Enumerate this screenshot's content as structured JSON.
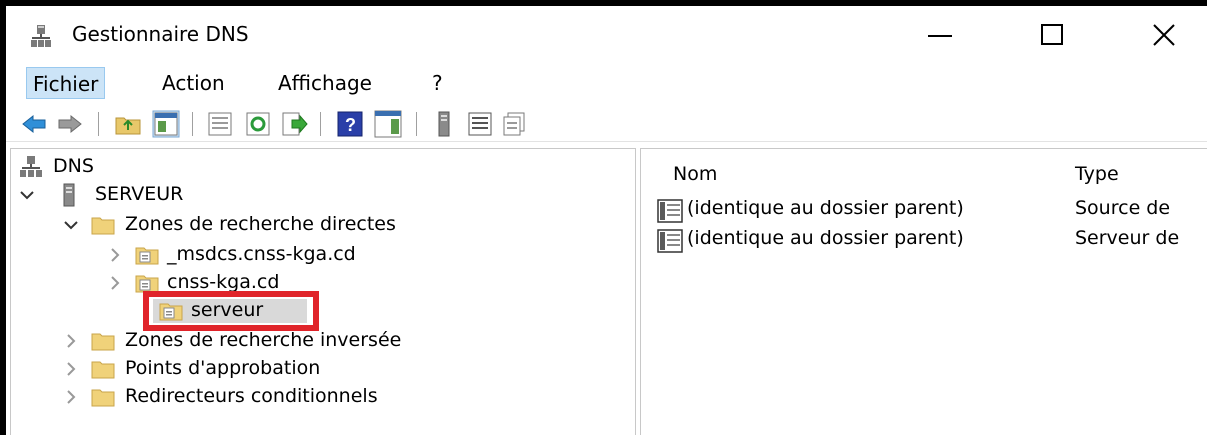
{
  "window": {
    "title": "Gestionnaire DNS"
  },
  "menu": [
    "Fichier",
    "Action",
    "Affichage",
    "?"
  ],
  "toolbar": {
    "icons": [
      "back-arrow-icon",
      "forward-arrow-icon",
      "up-folder-icon",
      "show-hide-tree-icon",
      "properties-icon",
      "refresh-icon",
      "export-list-icon",
      "help-icon",
      "show-hide-action-pane-icon",
      "server-icon",
      "list-view-icon",
      "copy-icon"
    ]
  },
  "tree": {
    "root": "DNS",
    "server": "SERVEUR",
    "forward_zones": "Zones de recherche directes",
    "zone1": "_msdcs.cnss-kga.cd",
    "zone2": "cnss-kga.cd",
    "zone3": "serveur",
    "reverse_zones": "Zones de recherche inversée",
    "trust_points": "Points d'approbation",
    "conditional_forwarders": "Redirecteurs conditionnels"
  },
  "list": {
    "columns": [
      "Nom",
      "Type"
    ],
    "rows": [
      {
        "name": "(identique au dossier parent)",
        "type": "Source de"
      },
      {
        "name": "(identique au dossier parent)",
        "type": "Serveur de"
      }
    ]
  },
  "colors": {
    "highlight_box": "#e0242a",
    "menu_active": "#cce4f7",
    "folder": "#e8c86a"
  }
}
